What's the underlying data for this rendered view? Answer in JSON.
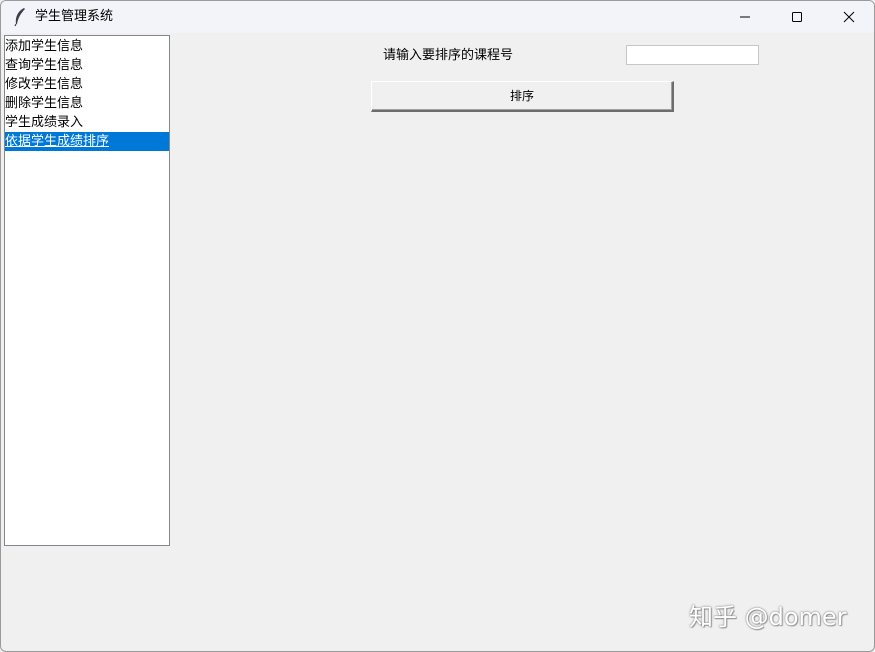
{
  "window": {
    "title": "学生管理系统",
    "icon": "feather-icon"
  },
  "titlebar_buttons": {
    "minimize": "minimize-icon",
    "maximize": "maximize-icon",
    "close": "close-icon"
  },
  "menu": {
    "items": [
      {
        "label": "添加学生信息"
      },
      {
        "label": "查询学生信息"
      },
      {
        "label": "修改学生信息"
      },
      {
        "label": "删除学生信息"
      },
      {
        "label": "学生成绩录入"
      },
      {
        "label": "依据学生成绩排序"
      }
    ],
    "selected_index": 5
  },
  "sort_panel": {
    "prompt": "请输入要排序的课程号",
    "course_value": "",
    "button_label": "排序"
  },
  "watermark": "知乎 @domer",
  "colors": {
    "selection_bg": "#0078d7",
    "window_bg": "#f0f0f0",
    "titlebar_bg": "#f3f4f9"
  }
}
